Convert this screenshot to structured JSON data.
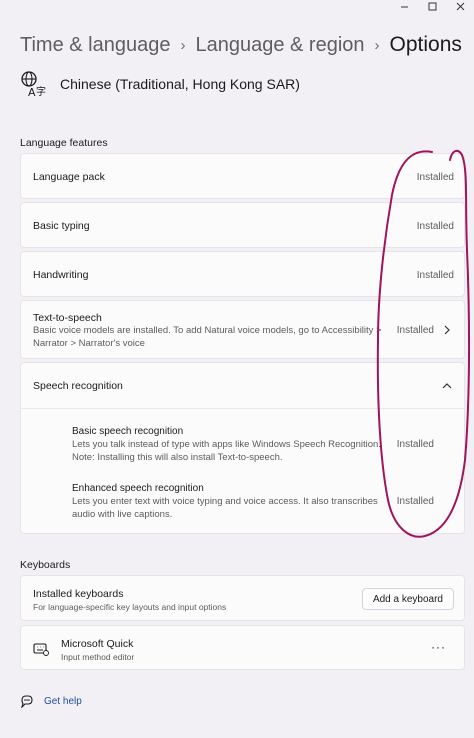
{
  "window": {
    "controls": [
      "minimize",
      "maximize",
      "close"
    ]
  },
  "breadcrumb": {
    "items": [
      "Time & language",
      "Language & region"
    ],
    "current": "Options"
  },
  "language": {
    "name": "Chinese (Traditional, Hong Kong SAR)",
    "icon": "language-icon"
  },
  "language_features": {
    "title": "Language features",
    "items": [
      {
        "label": "Language pack",
        "status": "Installed"
      },
      {
        "label": "Basic typing",
        "status": "Installed"
      },
      {
        "label": "Handwriting",
        "status": "Installed"
      },
      {
        "label": "Text-to-speech",
        "description_line1": "Basic voice models are installed. To add Natural voice models, go to Accessibility >",
        "description_line2": "Narrator > Narrator's voice",
        "status": "Installed"
      }
    ],
    "speech": {
      "label": "Speech recognition",
      "items": [
        {
          "label": "Basic speech recognition",
          "description_line1": "Lets you talk instead of type with apps like Windows Speech Recognition.",
          "description_line2": "Note: Installing this will also install Text-to-speech.",
          "status": "Installed"
        },
        {
          "label": "Enhanced speech recognition",
          "description_line1": "Lets you enter text with voice typing and voice access. It also transcribes",
          "description_line2": "audio with live captions.",
          "status": "Installed"
        }
      ]
    }
  },
  "keyboards": {
    "title": "Keyboards",
    "installed": {
      "label": "Installed keyboards",
      "description": "For language-specific key layouts and input options",
      "button": "Add a keyboard"
    },
    "items": [
      {
        "label": "Microsoft Quick",
        "description": "Input method editor",
        "more": "···"
      }
    ]
  },
  "help": {
    "label": "Get help"
  },
  "colors": {
    "annotation": "#a0145a",
    "accent": "#1b4fa0"
  }
}
